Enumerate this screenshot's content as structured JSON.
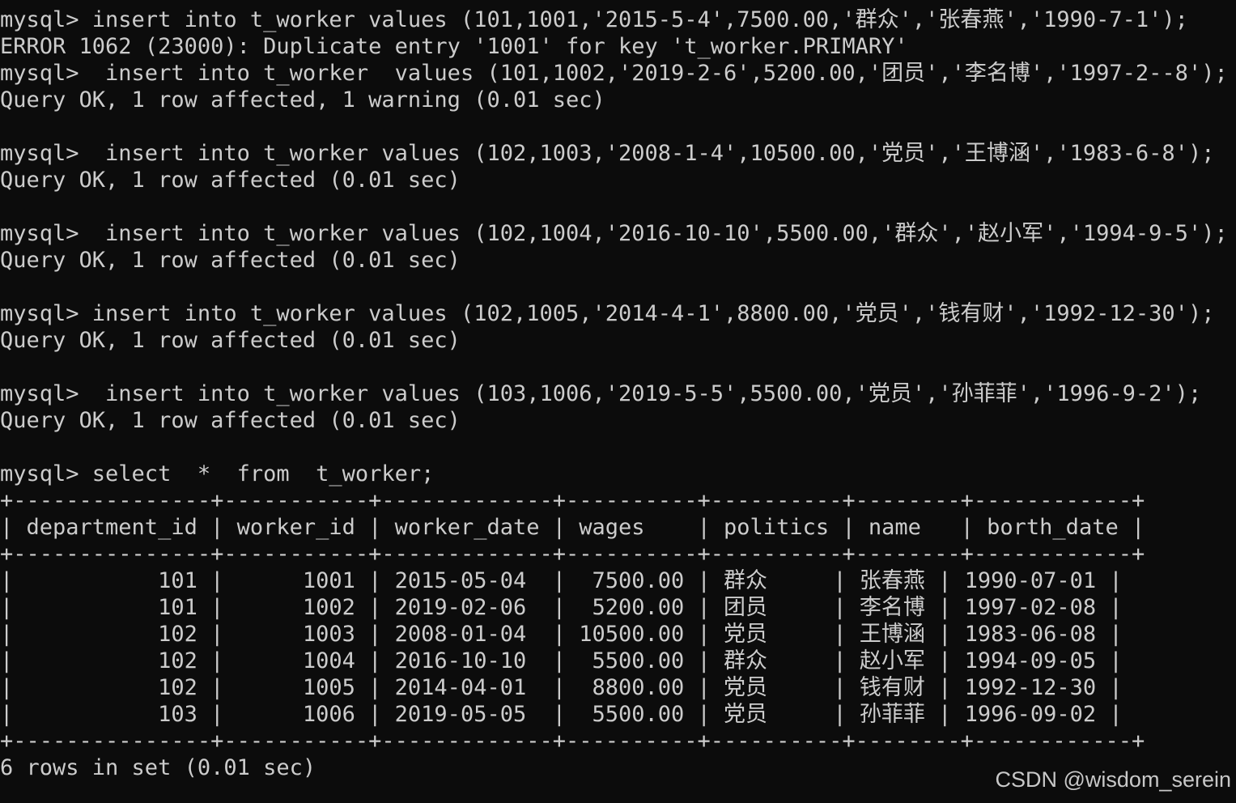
{
  "terminal": {
    "lines": [
      "mysql> insert into t_worker values (101,1001,'2015-5-4',7500.00,'群众','张春燕','1990-7-1');",
      "ERROR 1062 (23000): Duplicate entry '1001' for key 't_worker.PRIMARY'",
      "mysql>  insert into t_worker  values (101,1002,'2019-2-6',5200.00,'团员','李名博','1997-2--8');",
      "Query OK, 1 row affected, 1 warning (0.01 sec)",
      "",
      "mysql>  insert into t_worker values (102,1003,'2008-1-4',10500.00,'党员','王博涵','1983-6-8');",
      "Query OK, 1 row affected (0.01 sec)",
      "",
      "mysql>  insert into t_worker values (102,1004,'2016-10-10',5500.00,'群众','赵小军','1994-9-5');",
      "Query OK, 1 row affected (0.01 sec)",
      "",
      "mysql> insert into t_worker values (102,1005,'2014-4-1',8800.00,'党员','钱有财','1992-12-30');",
      "Query OK, 1 row affected (0.01 sec)",
      "",
      "mysql>  insert into t_worker values (103,1006,'2019-5-5',5500.00,'党员','孙菲菲','1996-9-2');",
      "Query OK, 1 row affected (0.01 sec)",
      "",
      "mysql> select  *  from  t_worker;"
    ],
    "table_lines": [
      "+---------------+-----------+-------------+----------+----------+--------+------------+",
      "| department_id | worker_id | worker_date | wages    | politics | name   | borth_date |",
      "+---------------+-----------+-------------+----------+----------+--------+------------+",
      "|           101 |      1001 | 2015-05-04  |  7500.00 | 群众     | 张春燕 | 1990-07-01 |",
      "|           101 |      1002 | 2019-02-06  |  5200.00 | 团员     | 李名博 | 1997-02-08 |",
      "|           102 |      1003 | 2008-01-04  | 10500.00 | 党员     | 王博涵 | 1983-06-08 |",
      "|           102 |      1004 | 2016-10-10  |  5500.00 | 群众     | 赵小军 | 1994-09-05 |",
      "|           102 |      1005 | 2014-04-01  |  8800.00 | 党员     | 钱有财 | 1992-12-30 |",
      "|           103 |      1006 | 2019-05-05  |  5500.00 | 党员     | 孙菲菲 | 1996-09-02 |",
      "+---------------+-----------+-------------+----------+----------+--------+------------+"
    ],
    "result_line": "6 rows in set (0.01 sec)"
  },
  "watermark": "CSDN @wisdom_serein",
  "colors": {
    "background": "#0c0c0c",
    "foreground": "#cccccc"
  }
}
